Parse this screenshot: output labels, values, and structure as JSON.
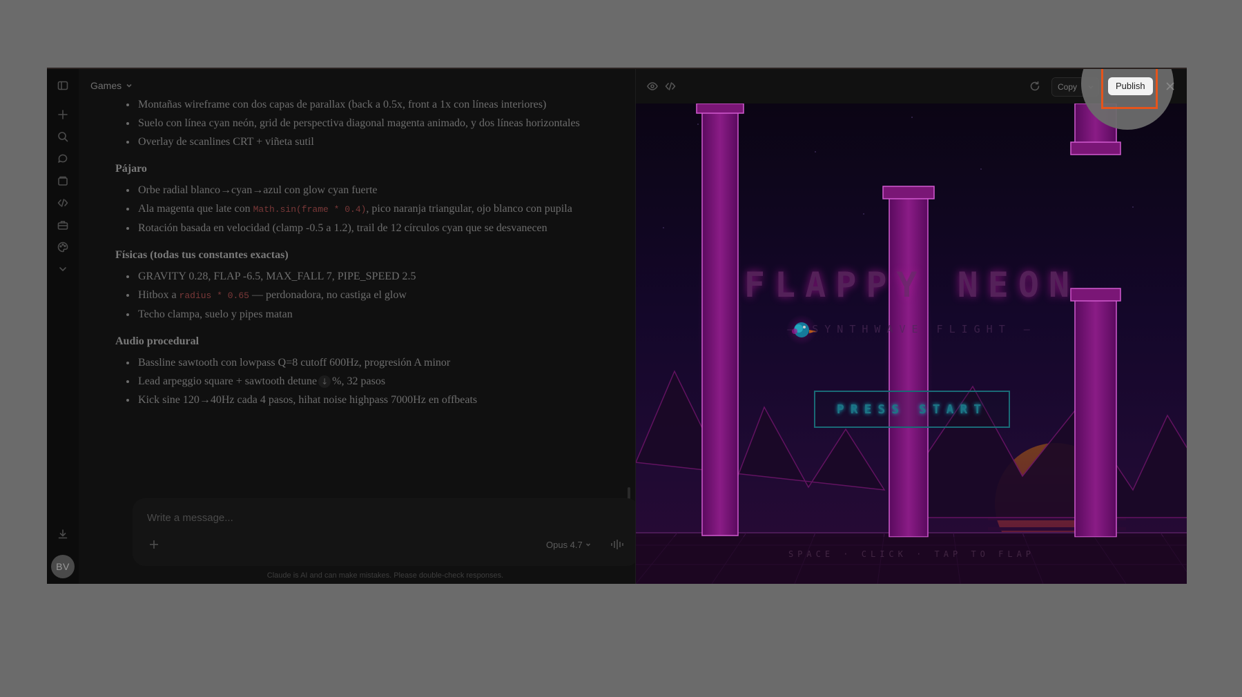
{
  "sidebar": {
    "avatar_initials": "BV",
    "icons": [
      "sidebar-toggle-icon",
      "plus-icon",
      "search-icon",
      "chats-icon",
      "projects-icon",
      "code-icon",
      "briefcase-icon",
      "palette-icon",
      "chevron-down-icon",
      "download-icon"
    ]
  },
  "chat": {
    "project_name": "Games",
    "sections": [
      {
        "items": [
          "Montañas wireframe con dos capas de parallax (back a 0.5x, front a 1x con líneas interiores)",
          "Suelo con línea cyan neón, grid de perspectiva diagonal magenta animado, y dos líneas horizontales",
          "Overlay de scanlines CRT + viñeta sutil"
        ]
      },
      {
        "title": "Pájaro",
        "items": [
          "Orbe radial blanco→cyan→azul con glow cyan fuerte",
          "Rotación basada en velocidad (clamp -0.5 a 1.2), trail de 12 círculos cyan que se desvanecen"
        ],
        "wing_item": {
          "before": "Ala magenta que late con ",
          "code": "Math.sin(frame * 0.4)",
          "after": ", pico naranja triangular, ojo blanco con pupila"
        }
      },
      {
        "title": "Físicas (todas tus constantes exactas)",
        "items": [
          "GRAVITY 0.28, FLAP -6.5, MAX_FALL 7, PIPE_SPEED 2.5",
          "Techo clampa, suelo y pipes matan"
        ],
        "hitbox_item": {
          "before": "Hitbox a ",
          "code": "radius * 0.65",
          "after": " — perdonadora, no castiga el glow"
        }
      },
      {
        "title": "Audio procedural",
        "items": [
          "Bassline sawtooth con lowpass Q=8 cutoff 600Hz, progresión A minor",
          "Kick sine 120→40Hz cada 4 pasos, hihat noise highpass 7000Hz en offbeats"
        ],
        "lead_item": {
          "before": "Lead arpeggio square + sawtooth detune",
          "arrow": "↓",
          "after": "%, 32 pasos"
        }
      }
    ],
    "composer": {
      "placeholder": "Write a message...",
      "model": "Opus 4.7"
    },
    "disclaimer": "Claude is AI and can make mistakes. Please double-check responses."
  },
  "artifact": {
    "toolbar": {
      "copy_label": "Copy",
      "publish_label": "Publish"
    },
    "game": {
      "title": "FLAPPY NEON",
      "subtitle": "— SYNTHWAVE FLIGHT —",
      "start_label": "PRESS START",
      "controls_hint": "SPACE · CLICK · TAP TO FLAP"
    },
    "colors": {
      "neon_magenta": "#c21aa8",
      "neon_cyan": "#12c3d6",
      "publish_highlight": "#e5541b"
    }
  }
}
